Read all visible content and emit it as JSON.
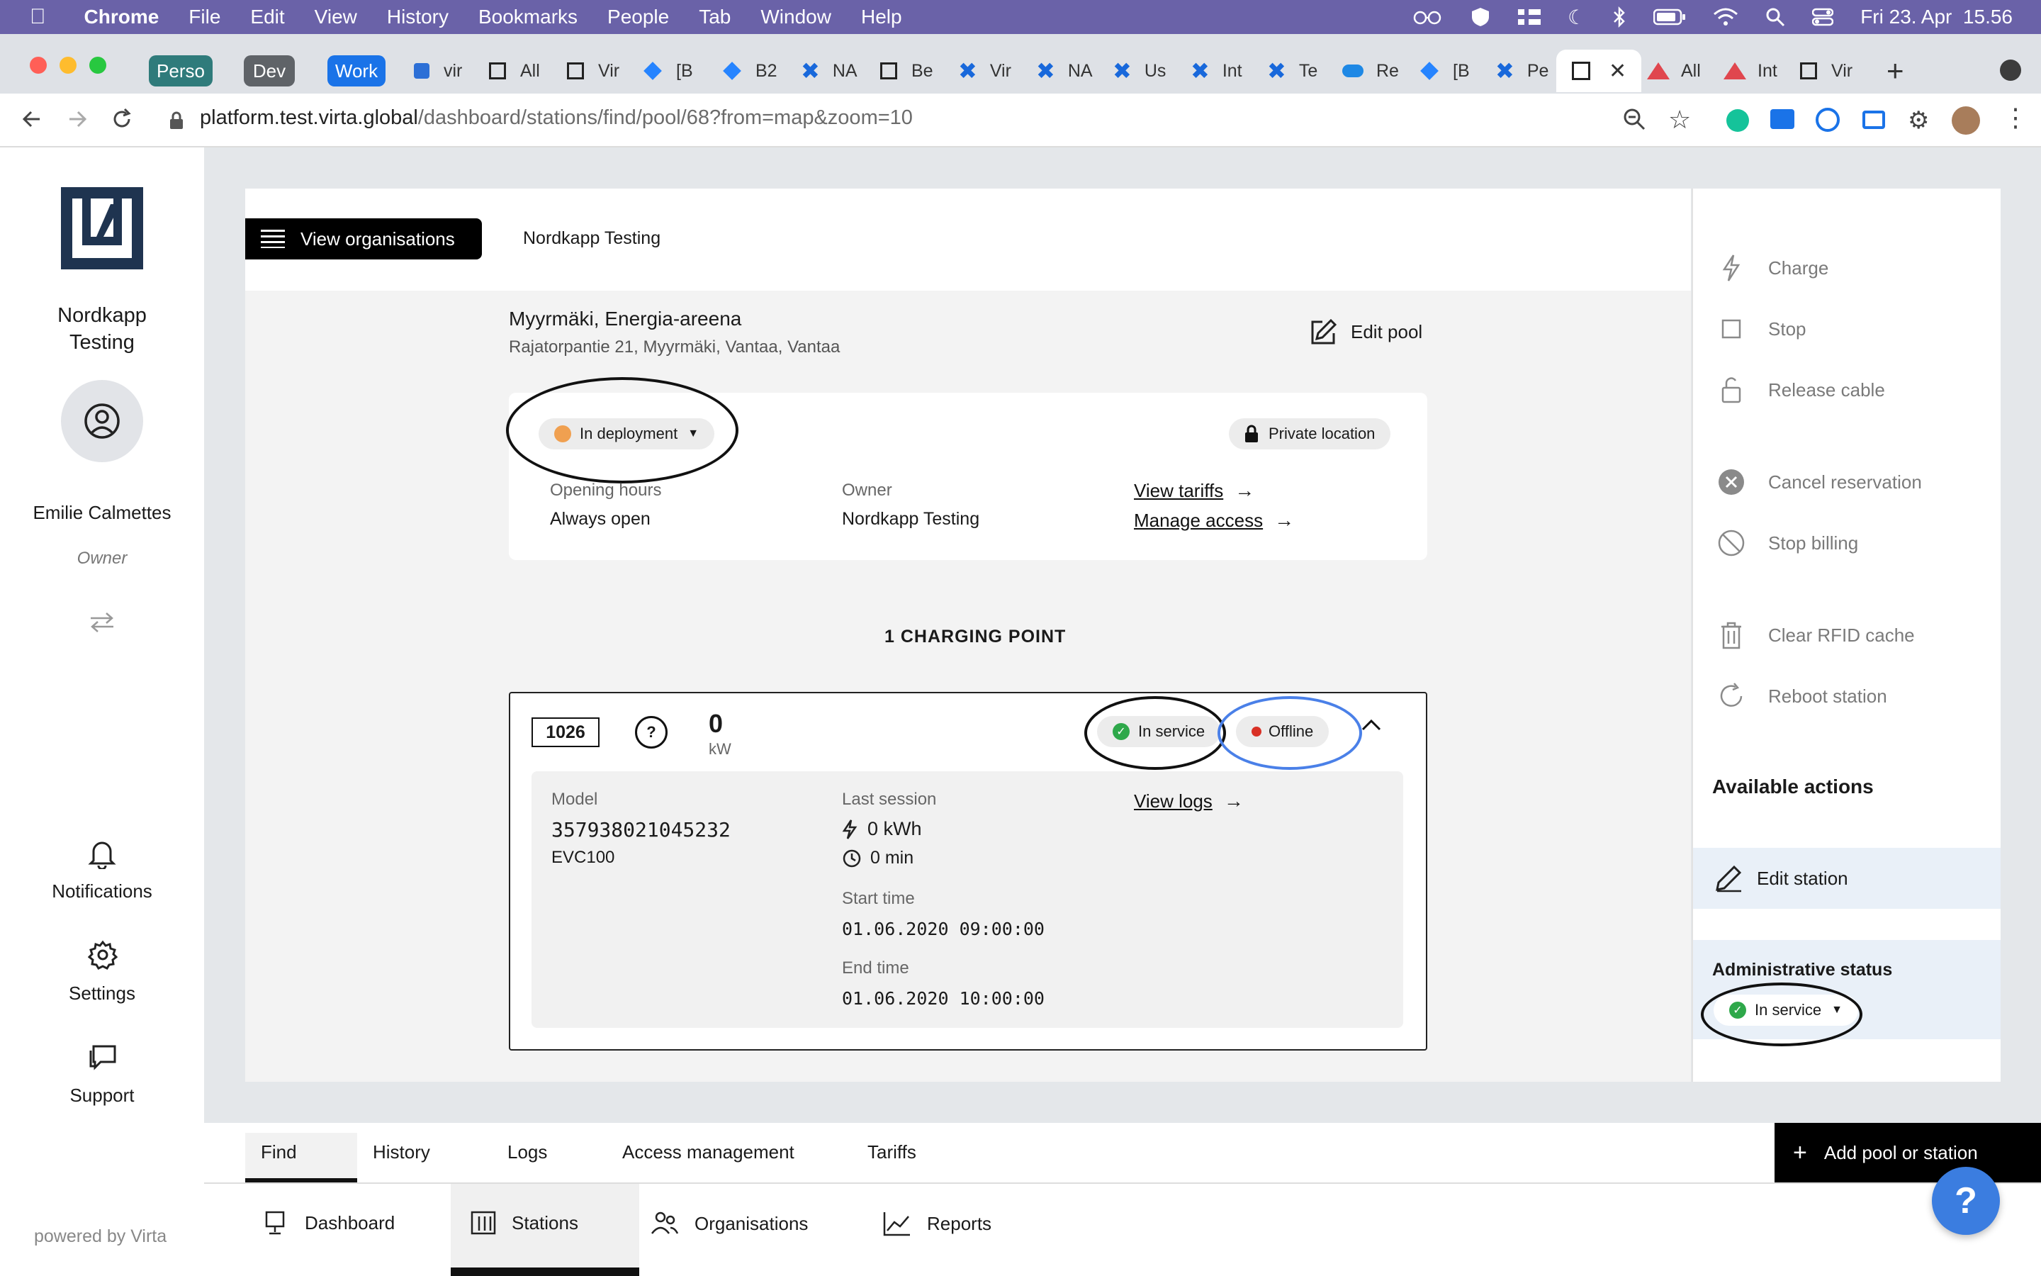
{
  "menubar": {
    "app": "Chrome",
    "items": [
      "File",
      "Edit",
      "View",
      "History",
      "Bookmarks",
      "People",
      "Tab",
      "Window",
      "Help"
    ],
    "clock": "Fri 23. Apr  15.56"
  },
  "tabs": {
    "groups": [
      {
        "label": "Perso",
        "color": "#2f7b7b"
      },
      {
        "label": "Dev",
        "color": "#5f6368"
      },
      {
        "label": "Work",
        "color": "#1a73e8"
      }
    ],
    "items": [
      "vir",
      "All",
      "Vir",
      "[B",
      "B2",
      "NA",
      "Be",
      "Vir",
      "NA",
      "Us",
      "Int",
      "Te",
      "Re",
      "[B",
      "Pe",
      "",
      "All",
      "Int",
      "Vir"
    ]
  },
  "address": {
    "host": "platform.test.virta.global",
    "path": "/dashboard/stations/find/pool/68?from=map&zoom=10"
  },
  "sidebar": {
    "org_name_line1": "Nordkapp",
    "org_name_line2": "Testing",
    "user_name": "Emilie Calmettes",
    "user_role": "Owner",
    "notifications": "Notifications",
    "settings": "Settings",
    "support": "Support",
    "powered_by": "powered by Virta"
  },
  "header": {
    "view_orgs": "View organisations",
    "org": "Nordkapp Testing"
  },
  "pool": {
    "name": "Myyrmäki, Energia-areena",
    "address": "Rajatorpantie 21, Myyrmäki, Vantaa, Vantaa",
    "edit": "Edit pool",
    "status": "In deployment",
    "location": "Private location",
    "hours_label": "Opening hours",
    "hours_value": "Always open",
    "owner_label": "Owner",
    "owner_value": "Nordkapp Testing",
    "view_tariffs": "View tariffs",
    "manage_access": "Manage access"
  },
  "charging": {
    "count_title": "1 CHARGING POINT",
    "id": "1026",
    "help": "?",
    "power_value": "0",
    "power_unit": "kW",
    "service_status": "In service",
    "connection_status": "Offline",
    "model_label": "Model",
    "model_number": "357938021045232",
    "model_name": "EVC100",
    "last_session_label": "Last session",
    "energy": "0 kWh",
    "duration": "0 min",
    "start_label": "Start time",
    "start_value": "01.06.2020 09:00:00",
    "end_label": "End time",
    "end_value": "01.06.2020 10:00:00",
    "view_logs": "View logs"
  },
  "actions": {
    "charge": "Charge",
    "stop": "Stop",
    "release": "Release cable",
    "cancel": "Cancel reservation",
    "stop_billing": "Stop billing",
    "clear_rfid": "Clear RFID cache",
    "reboot": "Reboot station",
    "available_title": "Available actions",
    "edit_station": "Edit station",
    "admin_title": "Administrative status",
    "admin_value": "In service"
  },
  "subtabs": {
    "find": "Find",
    "history": "History",
    "logs": "Logs",
    "access": "Access management",
    "tariffs": "Tariffs",
    "add": "Add pool or station"
  },
  "bottom_nav": {
    "dashboard": "Dashboard",
    "stations": "Stations",
    "organisations": "Organisations",
    "reports": "Reports"
  },
  "colors": {
    "menubar": "#6a62a8",
    "accent": "#000000",
    "success": "#2ea84a",
    "danger": "#d93025",
    "warning": "#f0a050",
    "help_button": "#3b7de0",
    "annotation_blue": "#4a80e8"
  }
}
